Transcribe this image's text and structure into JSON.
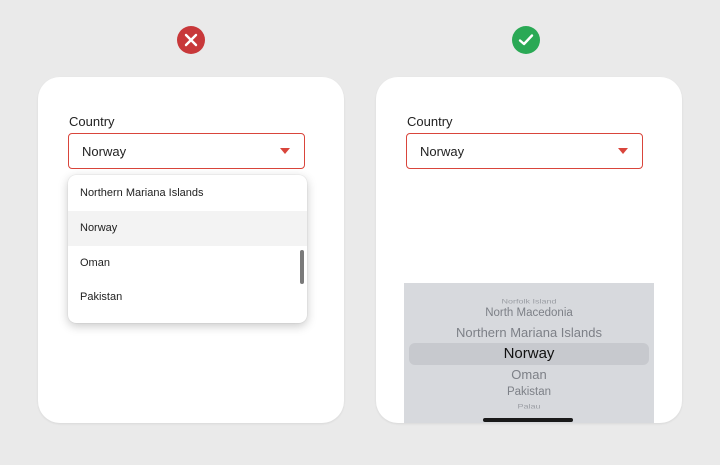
{
  "colors": {
    "bad": "#c8383a",
    "good": "#2aa955",
    "accent": "#d9453b"
  },
  "left_panel": {
    "badge_icon": "cross-icon",
    "field_label": "Country",
    "selected_value": "Norway",
    "options": [
      "Northern Mariana Islands",
      "Norway",
      "Oman",
      "Pakistan"
    ],
    "highlighted_option": "Norway"
  },
  "right_panel": {
    "badge_icon": "check-icon",
    "field_label": "Country",
    "selected_value": "Norway",
    "wheel_items": [
      "Norfolk Island",
      "North Macedonia",
      "Northern Mariana Islands",
      "Norway",
      "Oman",
      "Pakistan",
      "Palau"
    ]
  }
}
